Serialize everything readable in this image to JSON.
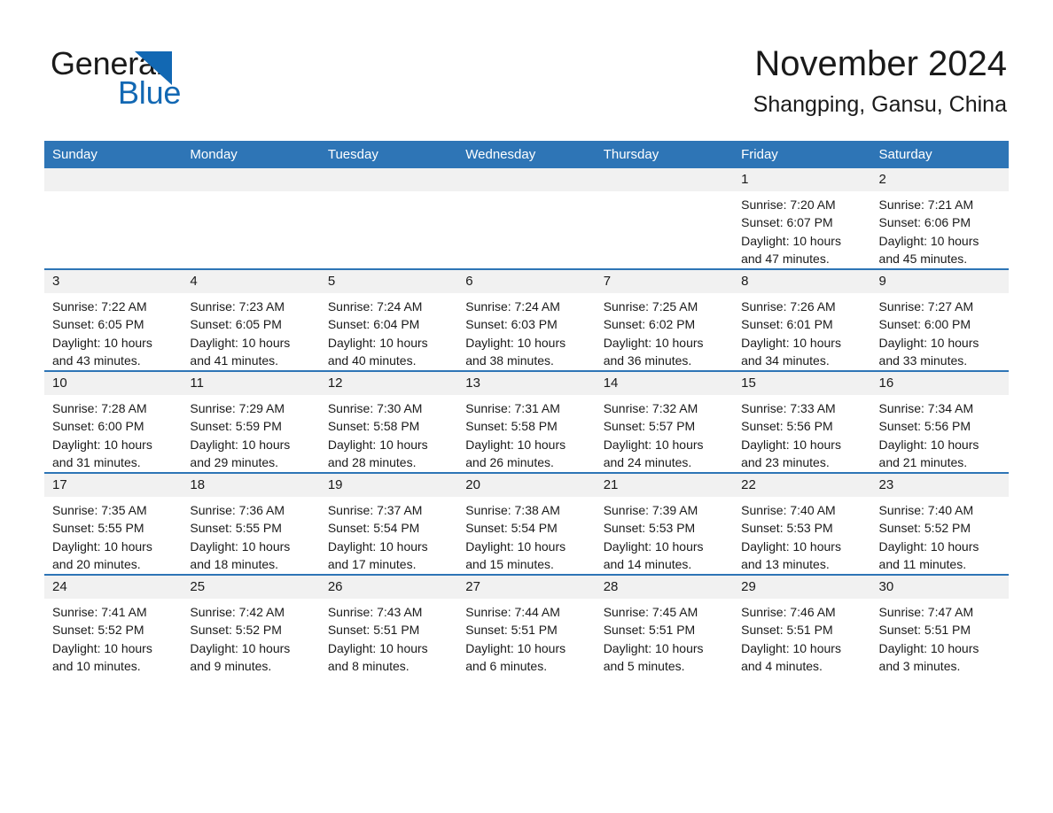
{
  "brand": {
    "name_part1": "General",
    "name_part2": "Blue",
    "logo_icon": "triangle-icon",
    "accent_color": "#1268b3"
  },
  "header": {
    "title": "November 2024",
    "subtitle": "Shangping, Gansu, China"
  },
  "calendar": {
    "header_bg": "#2e75b6",
    "daynum_bg": "#f1f1f1",
    "weekdays": [
      "Sunday",
      "Monday",
      "Tuesday",
      "Wednesday",
      "Thursday",
      "Friday",
      "Saturday"
    ],
    "weeks": [
      [
        {
          "day": "",
          "sunrise": "",
          "sunset": "",
          "daylight": ""
        },
        {
          "day": "",
          "sunrise": "",
          "sunset": "",
          "daylight": ""
        },
        {
          "day": "",
          "sunrise": "",
          "sunset": "",
          "daylight": ""
        },
        {
          "day": "",
          "sunrise": "",
          "sunset": "",
          "daylight": ""
        },
        {
          "day": "",
          "sunrise": "",
          "sunset": "",
          "daylight": ""
        },
        {
          "day": "1",
          "sunrise": "Sunrise: 7:20 AM",
          "sunset": "Sunset: 6:07 PM",
          "daylight": "Daylight: 10 hours and 47 minutes."
        },
        {
          "day": "2",
          "sunrise": "Sunrise: 7:21 AM",
          "sunset": "Sunset: 6:06 PM",
          "daylight": "Daylight: 10 hours and 45 minutes."
        }
      ],
      [
        {
          "day": "3",
          "sunrise": "Sunrise: 7:22 AM",
          "sunset": "Sunset: 6:05 PM",
          "daylight": "Daylight: 10 hours and 43 minutes."
        },
        {
          "day": "4",
          "sunrise": "Sunrise: 7:23 AM",
          "sunset": "Sunset: 6:05 PM",
          "daylight": "Daylight: 10 hours and 41 minutes."
        },
        {
          "day": "5",
          "sunrise": "Sunrise: 7:24 AM",
          "sunset": "Sunset: 6:04 PM",
          "daylight": "Daylight: 10 hours and 40 minutes."
        },
        {
          "day": "6",
          "sunrise": "Sunrise: 7:24 AM",
          "sunset": "Sunset: 6:03 PM",
          "daylight": "Daylight: 10 hours and 38 minutes."
        },
        {
          "day": "7",
          "sunrise": "Sunrise: 7:25 AM",
          "sunset": "Sunset: 6:02 PM",
          "daylight": "Daylight: 10 hours and 36 minutes."
        },
        {
          "day": "8",
          "sunrise": "Sunrise: 7:26 AM",
          "sunset": "Sunset: 6:01 PM",
          "daylight": "Daylight: 10 hours and 34 minutes."
        },
        {
          "day": "9",
          "sunrise": "Sunrise: 7:27 AM",
          "sunset": "Sunset: 6:00 PM",
          "daylight": "Daylight: 10 hours and 33 minutes."
        }
      ],
      [
        {
          "day": "10",
          "sunrise": "Sunrise: 7:28 AM",
          "sunset": "Sunset: 6:00 PM",
          "daylight": "Daylight: 10 hours and 31 minutes."
        },
        {
          "day": "11",
          "sunrise": "Sunrise: 7:29 AM",
          "sunset": "Sunset: 5:59 PM",
          "daylight": "Daylight: 10 hours and 29 minutes."
        },
        {
          "day": "12",
          "sunrise": "Sunrise: 7:30 AM",
          "sunset": "Sunset: 5:58 PM",
          "daylight": "Daylight: 10 hours and 28 minutes."
        },
        {
          "day": "13",
          "sunrise": "Sunrise: 7:31 AM",
          "sunset": "Sunset: 5:58 PM",
          "daylight": "Daylight: 10 hours and 26 minutes."
        },
        {
          "day": "14",
          "sunrise": "Sunrise: 7:32 AM",
          "sunset": "Sunset: 5:57 PM",
          "daylight": "Daylight: 10 hours and 24 minutes."
        },
        {
          "day": "15",
          "sunrise": "Sunrise: 7:33 AM",
          "sunset": "Sunset: 5:56 PM",
          "daylight": "Daylight: 10 hours and 23 minutes."
        },
        {
          "day": "16",
          "sunrise": "Sunrise: 7:34 AM",
          "sunset": "Sunset: 5:56 PM",
          "daylight": "Daylight: 10 hours and 21 minutes."
        }
      ],
      [
        {
          "day": "17",
          "sunrise": "Sunrise: 7:35 AM",
          "sunset": "Sunset: 5:55 PM",
          "daylight": "Daylight: 10 hours and 20 minutes."
        },
        {
          "day": "18",
          "sunrise": "Sunrise: 7:36 AM",
          "sunset": "Sunset: 5:55 PM",
          "daylight": "Daylight: 10 hours and 18 minutes."
        },
        {
          "day": "19",
          "sunrise": "Sunrise: 7:37 AM",
          "sunset": "Sunset: 5:54 PM",
          "daylight": "Daylight: 10 hours and 17 minutes."
        },
        {
          "day": "20",
          "sunrise": "Sunrise: 7:38 AM",
          "sunset": "Sunset: 5:54 PM",
          "daylight": "Daylight: 10 hours and 15 minutes."
        },
        {
          "day": "21",
          "sunrise": "Sunrise: 7:39 AM",
          "sunset": "Sunset: 5:53 PM",
          "daylight": "Daylight: 10 hours and 14 minutes."
        },
        {
          "day": "22",
          "sunrise": "Sunrise: 7:40 AM",
          "sunset": "Sunset: 5:53 PM",
          "daylight": "Daylight: 10 hours and 13 minutes."
        },
        {
          "day": "23",
          "sunrise": "Sunrise: 7:40 AM",
          "sunset": "Sunset: 5:52 PM",
          "daylight": "Daylight: 10 hours and 11 minutes."
        }
      ],
      [
        {
          "day": "24",
          "sunrise": "Sunrise: 7:41 AM",
          "sunset": "Sunset: 5:52 PM",
          "daylight": "Daylight: 10 hours and 10 minutes."
        },
        {
          "day": "25",
          "sunrise": "Sunrise: 7:42 AM",
          "sunset": "Sunset: 5:52 PM",
          "daylight": "Daylight: 10 hours and 9 minutes."
        },
        {
          "day": "26",
          "sunrise": "Sunrise: 7:43 AM",
          "sunset": "Sunset: 5:51 PM",
          "daylight": "Daylight: 10 hours and 8 minutes."
        },
        {
          "day": "27",
          "sunrise": "Sunrise: 7:44 AM",
          "sunset": "Sunset: 5:51 PM",
          "daylight": "Daylight: 10 hours and 6 minutes."
        },
        {
          "day": "28",
          "sunrise": "Sunrise: 7:45 AM",
          "sunset": "Sunset: 5:51 PM",
          "daylight": "Daylight: 10 hours and 5 minutes."
        },
        {
          "day": "29",
          "sunrise": "Sunrise: 7:46 AM",
          "sunset": "Sunset: 5:51 PM",
          "daylight": "Daylight: 10 hours and 4 minutes."
        },
        {
          "day": "30",
          "sunrise": "Sunrise: 7:47 AM",
          "sunset": "Sunset: 5:51 PM",
          "daylight": "Daylight: 10 hours and 3 minutes."
        }
      ]
    ]
  }
}
